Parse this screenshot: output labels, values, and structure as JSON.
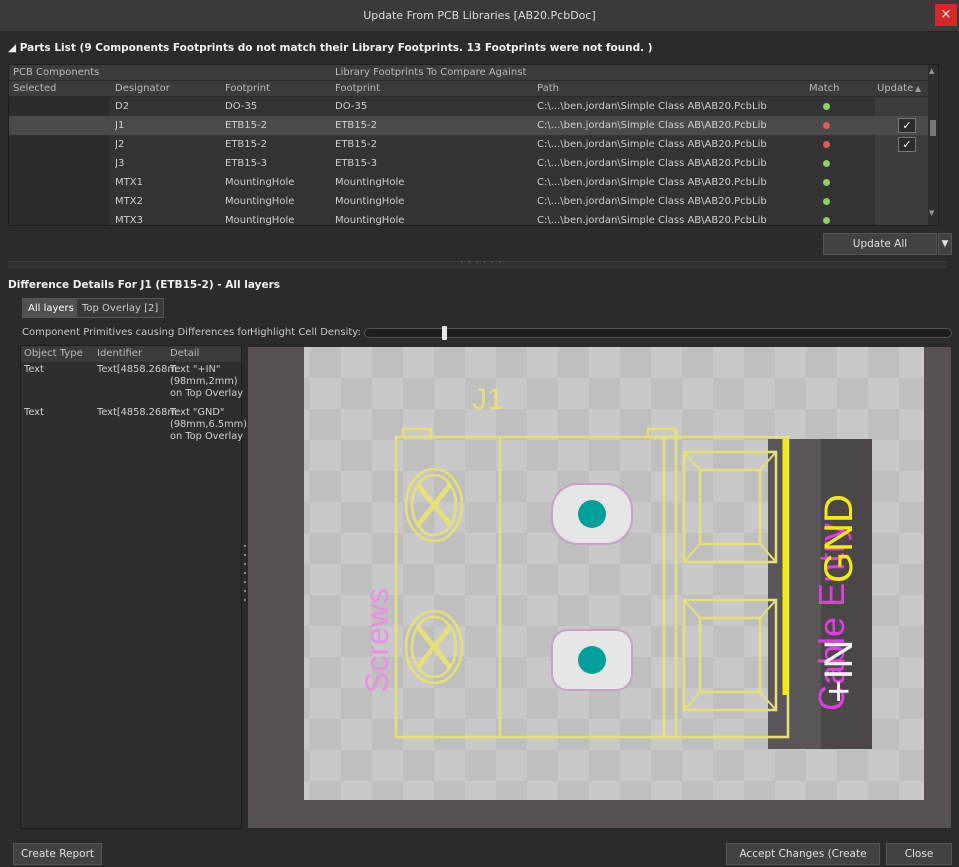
{
  "window": {
    "title": "Update From PCB Libraries [AB20.PcbDoc]",
    "close_glyph": "×"
  },
  "parts_list": {
    "header": "◢ Parts List (9 Components Footprints do not match their Library Footprints. 13 Footprints were not found. )",
    "group_headers": {
      "pcb_components": "PCB Components",
      "library_footprints": "Library Footprints To Compare Against"
    },
    "columns": {
      "selected": "Selected",
      "designator": "Designator",
      "footprint": "Footprint",
      "lib_footprint": "Footprint",
      "path": "Path",
      "match": "Match",
      "update": "Update"
    },
    "rows": [
      {
        "designator": "D2",
        "footprint": "DO-35",
        "lib_footprint": "DO-35",
        "path": "C:\\...\\ben.jordan\\Simple Class AB\\AB20.PcbLib",
        "match": "ok",
        "update": false
      },
      {
        "designator": "J1",
        "footprint": "ETB15-2",
        "lib_footprint": "ETB15-2",
        "path": "C:\\...\\ben.jordan\\Simple Class AB\\AB20.PcbLib",
        "match": "bad",
        "update": true
      },
      {
        "designator": "J2",
        "footprint": "ETB15-2",
        "lib_footprint": "ETB15-2",
        "path": "C:\\...\\ben.jordan\\Simple Class AB\\AB20.PcbLib",
        "match": "bad",
        "update": true
      },
      {
        "designator": "J3",
        "footprint": "ETB15-3",
        "lib_footprint": "ETB15-3",
        "path": "C:\\...\\ben.jordan\\Simple Class AB\\AB20.PcbLib",
        "match": "ok",
        "update": false
      },
      {
        "designator": "MTX1",
        "footprint": "MountingHole",
        "lib_footprint": "MountingHole",
        "path": "C:\\...\\ben.jordan\\Simple Class AB\\AB20.PcbLib",
        "match": "ok",
        "update": false
      },
      {
        "designator": "MTX2",
        "footprint": "MountingHole",
        "lib_footprint": "MountingHole",
        "path": "C:\\...\\ben.jordan\\Simple Class AB\\AB20.PcbLib",
        "match": "ok",
        "update": false
      },
      {
        "designator": "MTX3",
        "footprint": "MountingHole",
        "lib_footprint": "MountingHole",
        "path": "C:\\...\\ben.jordan\\Simple Class AB\\AB20.PcbLib",
        "match": "ok",
        "update": false
      }
    ],
    "update_all_label": "Update All",
    "splitter_dots": "· · · · · ·"
  },
  "difference": {
    "header": "Difference Details For J1 (ETB15-2) - All layers",
    "tabs": [
      "All layers",
      "Top Overlay [2]"
    ],
    "primitives_label": "Component Primitives causing Differences for ...",
    "density_label": "Highlight Cell Density:",
    "density_value": 0.14,
    "columns": {
      "object_type": "Object Type",
      "identifier": "Identifier",
      "detail": "Detail"
    },
    "rows": [
      {
        "object_type": "Text",
        "identifier": "Text[4858.268m",
        "detail": [
          "Text \"+IN\"",
          "(98mm,2mm)",
          "on Top Overlay"
        ]
      },
      {
        "object_type": "Text",
        "identifier": "Text[4858.268m",
        "detail": [
          "Text \"GND\"",
          "(98mm,6.5mm)",
          "on Top Overlay"
        ]
      }
    ]
  },
  "viewer": {
    "designator_text": "J1",
    "screws_text": "Screws",
    "cable_text": "Cable Entry",
    "gnd_text": "GND",
    "in_text": "+IN",
    "colors": {
      "overlay": "#e7e07a",
      "pad": "#00a09a",
      "magenta": "#e23de0",
      "yellow": "#f4ee00",
      "white": "#f2f2f2"
    }
  },
  "footer": {
    "create_report": "Create Report",
    "accept_changes": "Accept Changes (Create ECO)",
    "close": "Close"
  }
}
